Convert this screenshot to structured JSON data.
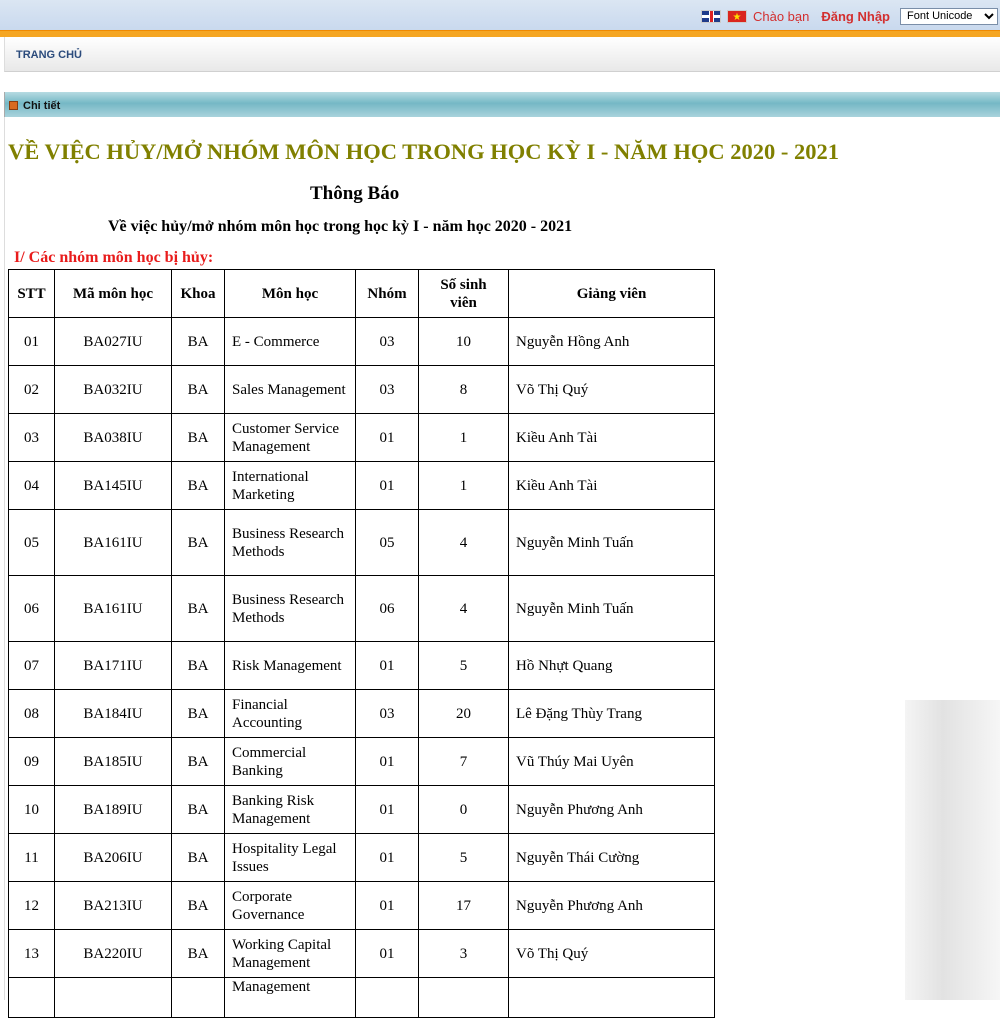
{
  "topbar": {
    "greeting": "Chào bạn",
    "login_label": "Đăng Nhập",
    "font_select_value": "Font Unicode"
  },
  "nav": {
    "home_label": "TRANG CHỦ"
  },
  "section_header": {
    "title": "Chi tiết"
  },
  "article": {
    "headline": "VỀ VIỆC HỦY/MỞ NHÓM MÔN HỌC TRONG HỌC KỲ I - NĂM HỌC 2020 - 2021",
    "notice_title": "Thông Báo",
    "notice_subtitle": "Về việc hủy/mở nhóm môn học trong học kỳ I - năm học 2020 - 2021",
    "section_label": "I/ Các nhóm môn học bị hủy:"
  },
  "table": {
    "headers": [
      "STT",
      "Mã môn học",
      "Khoa",
      "Môn học",
      "Nhóm",
      "Số sinh viên",
      "Giảng viên"
    ],
    "rows": [
      {
        "stt": "01",
        "code": "BA027IU",
        "khoa": "BA",
        "mon": "E - Commerce",
        "nhom": "03",
        "sv": "10",
        "gv": "Nguyễn Hồng Anh"
      },
      {
        "stt": "02",
        "code": "BA032IU",
        "khoa": "BA",
        "mon": "Sales Management",
        "nhom": "03",
        "sv": "8",
        "gv": "Võ Thị Quý"
      },
      {
        "stt": "03",
        "code": "BA038IU",
        "khoa": "BA",
        "mon": "Customer Service Management",
        "nhom": "01",
        "sv": "1",
        "gv": "Kiều Anh Tài"
      },
      {
        "stt": "04",
        "code": "BA145IU",
        "khoa": "BA",
        "mon": "International Marketing",
        "nhom": "01",
        "sv": "1",
        "gv": "Kiều Anh Tài"
      },
      {
        "stt": "05",
        "code": "BA161IU",
        "khoa": "BA",
        "mon": "Business Research Methods",
        "nhom": "05",
        "sv": "4",
        "gv": "Nguyễn Minh Tuấn"
      },
      {
        "stt": "06",
        "code": "BA161IU",
        "khoa": "BA",
        "mon": "Business Research Methods",
        "nhom": "06",
        "sv": "4",
        "gv": "Nguyễn Minh Tuấn"
      },
      {
        "stt": "07",
        "code": "BA171IU",
        "khoa": "BA",
        "mon": "Risk Management",
        "nhom": "01",
        "sv": "5",
        "gv": "Hồ Nhựt Quang"
      },
      {
        "stt": "08",
        "code": "BA184IU",
        "khoa": "BA",
        "mon": "Financial Accounting",
        "nhom": "03",
        "sv": "20",
        "gv": "Lê Đặng Thùy Trang"
      },
      {
        "stt": "09",
        "code": "BA185IU",
        "khoa": "BA",
        "mon": "Commercial Banking",
        "nhom": "01",
        "sv": "7",
        "gv": "Vũ Thúy Mai Uyên"
      },
      {
        "stt": "10",
        "code": "BA189IU",
        "khoa": "BA",
        "mon": "Banking Risk Management",
        "nhom": "01",
        "sv": "0",
        "gv": "Nguyễn Phương Anh"
      },
      {
        "stt": "11",
        "code": "BA206IU",
        "khoa": "BA",
        "mon": "Hospitality Legal Issues",
        "nhom": "01",
        "sv": "5",
        "gv": "Nguyễn Thái Cường"
      },
      {
        "stt": "12",
        "code": "BA213IU",
        "khoa": "BA",
        "mon": "Corporate Governance",
        "nhom": "01",
        "sv": "17",
        "gv": "Nguyễn Phương Anh"
      },
      {
        "stt": "13",
        "code": "BA220IU",
        "khoa": "BA",
        "mon": "Working Capital Management",
        "nhom": "01",
        "sv": "3",
        "gv": "Võ Thị Quý"
      },
      {
        "stt": "",
        "code": "",
        "khoa": "",
        "mon": "Management",
        "nhom": "",
        "sv": "",
        "gv": ""
      }
    ]
  }
}
